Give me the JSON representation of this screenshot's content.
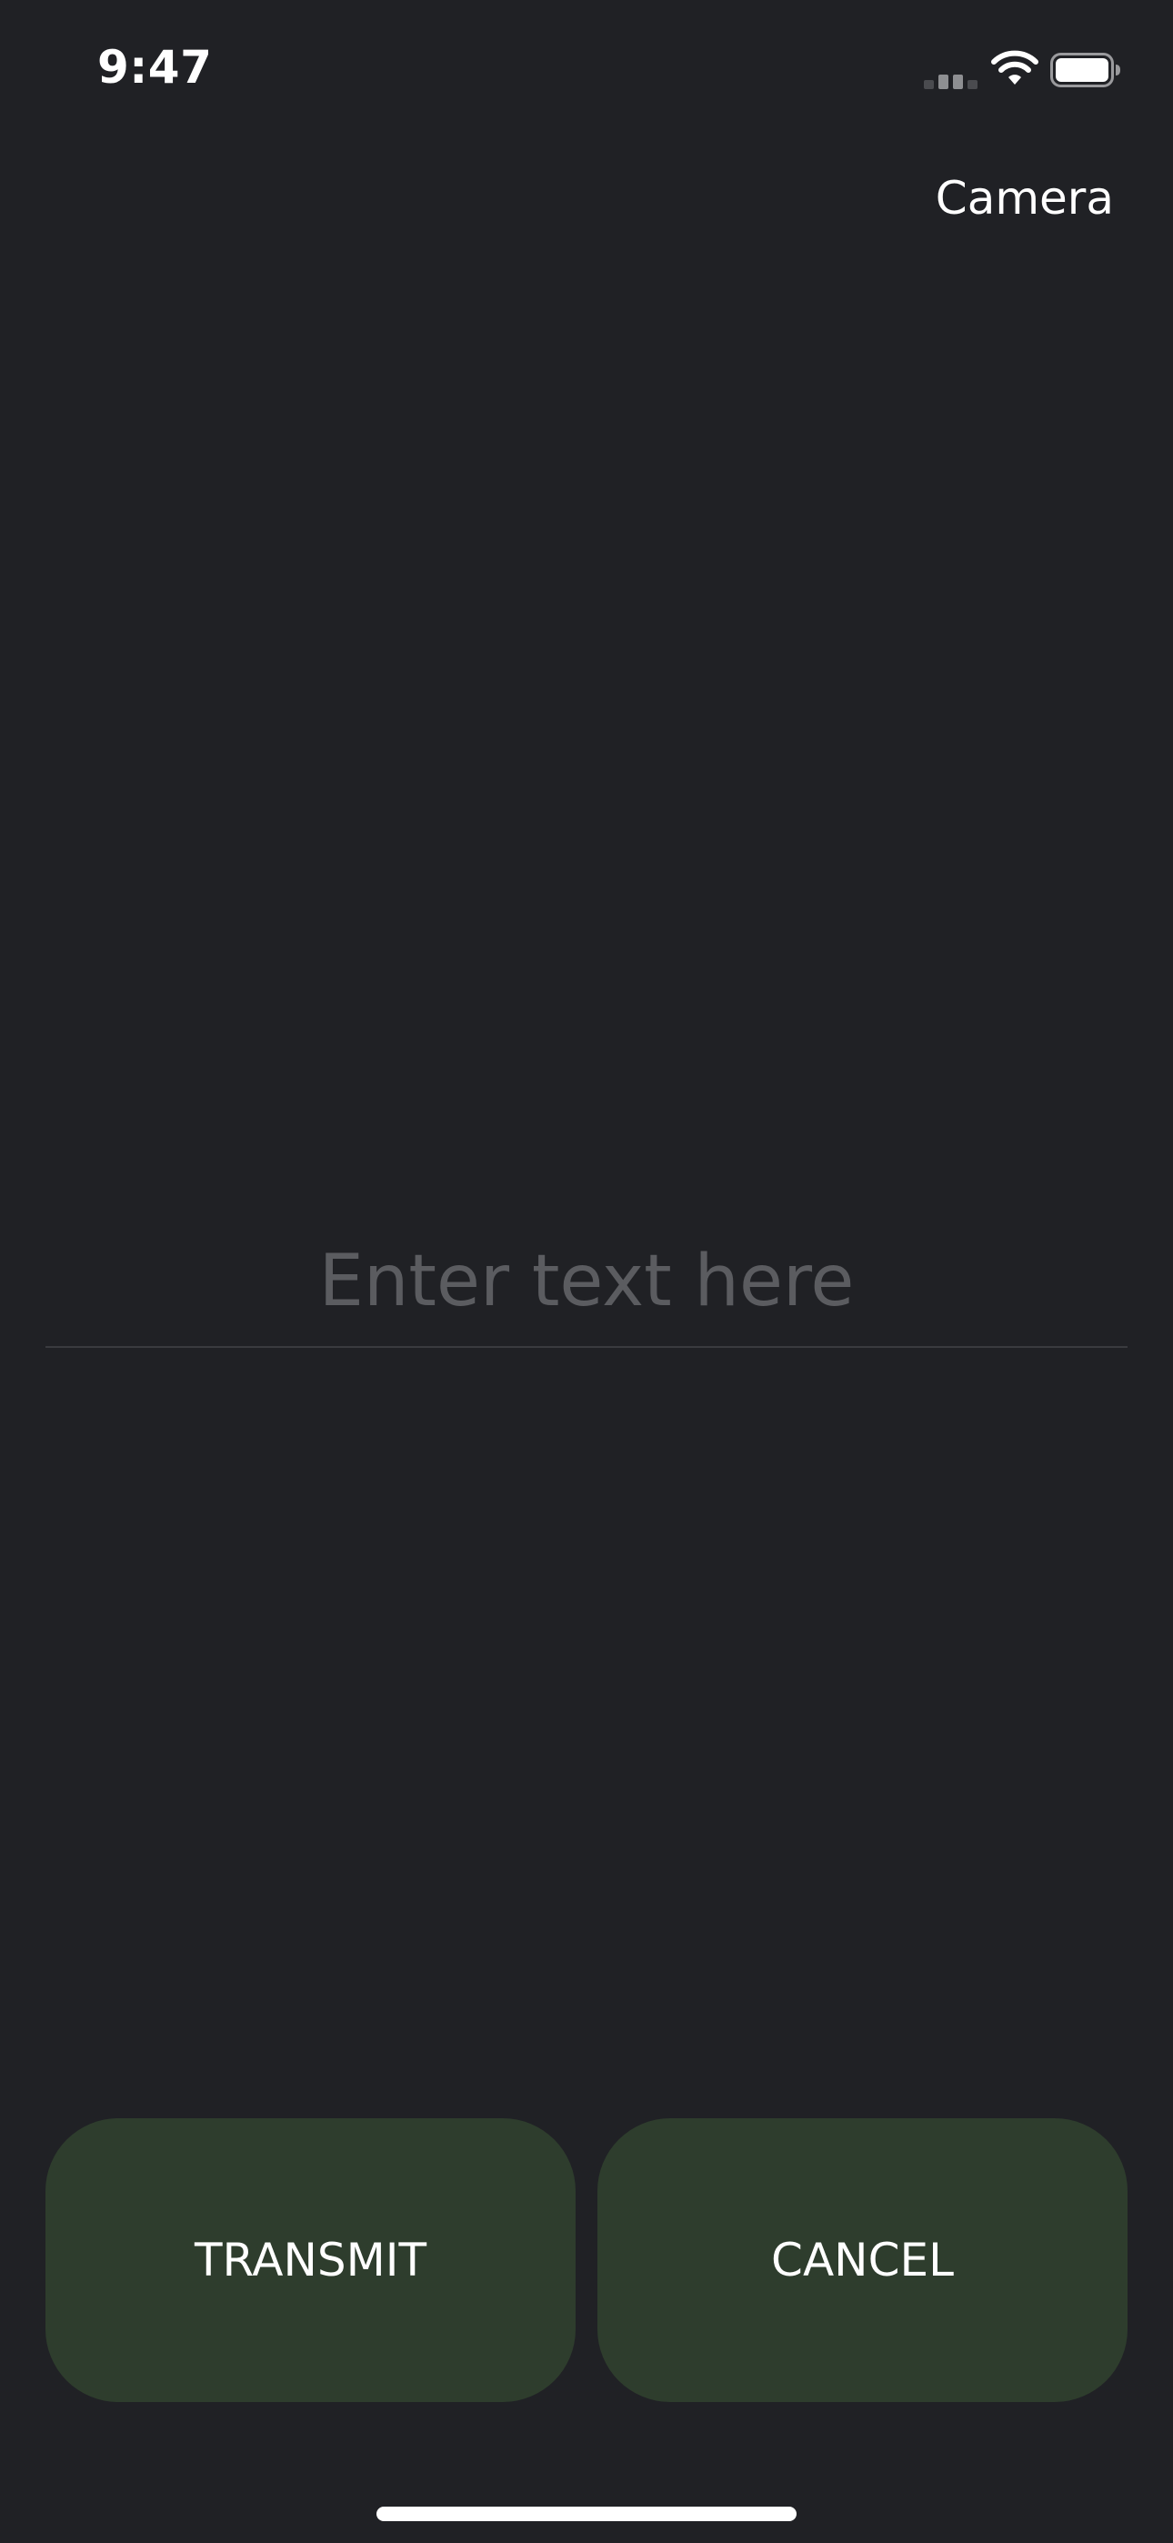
{
  "status_bar": {
    "time": "9:47",
    "icons": [
      "cellular-signal-icon",
      "wifi-icon",
      "battery-icon"
    ]
  },
  "nav": {
    "camera_label": "Camera"
  },
  "text_field": {
    "placeholder": "Enter text here",
    "value": ""
  },
  "actions": {
    "transmit_label": "TRANSMIT",
    "cancel_label": "CANCEL"
  },
  "colors": {
    "background": "#202125",
    "button_background": "#2e3d2d",
    "placeholder_text": "#5b5c60",
    "text": "#ffffff"
  }
}
